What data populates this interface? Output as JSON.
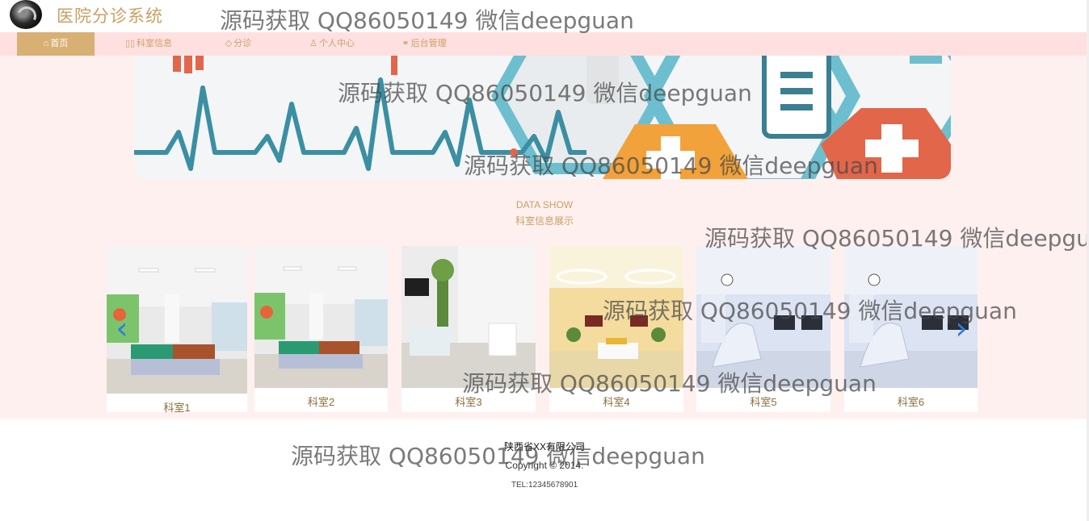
{
  "header": {
    "title": "医院分诊系统"
  },
  "nav": {
    "items": [
      {
        "icon": "⌂",
        "label": "首页"
      },
      {
        "icon": "▯▯",
        "label": "科室信息"
      },
      {
        "icon": "◇",
        "label": "分诊"
      },
      {
        "icon": "♙",
        "label": "个人中心"
      },
      {
        "icon": "⚭",
        "label": "后台管理"
      }
    ]
  },
  "section": {
    "title_en": "DATA SHOW",
    "title_cn": "科室信息展示"
  },
  "departments": [
    {
      "label": "科室1"
    },
    {
      "label": "科室2"
    },
    {
      "label": "科室3"
    },
    {
      "label": "科室4"
    },
    {
      "label": "科室5"
    },
    {
      "label": "科室6"
    }
  ],
  "carousel": {
    "prev_icon": "chevron-left-icon",
    "next_icon": "chevron-right-icon"
  },
  "footer": {
    "company": "陕西省XX有限公司",
    "copyright": "Copyright © 2014.",
    "tel": "TEL:12345678901"
  },
  "watermark": {
    "text": "源码获取 QQ86050149 微信deepguan"
  },
  "colors": {
    "accent": "#c9a062",
    "nav_bg": "#ffe0e0",
    "content_bg": "#fff0f0",
    "active_tab": "#d8b074"
  }
}
